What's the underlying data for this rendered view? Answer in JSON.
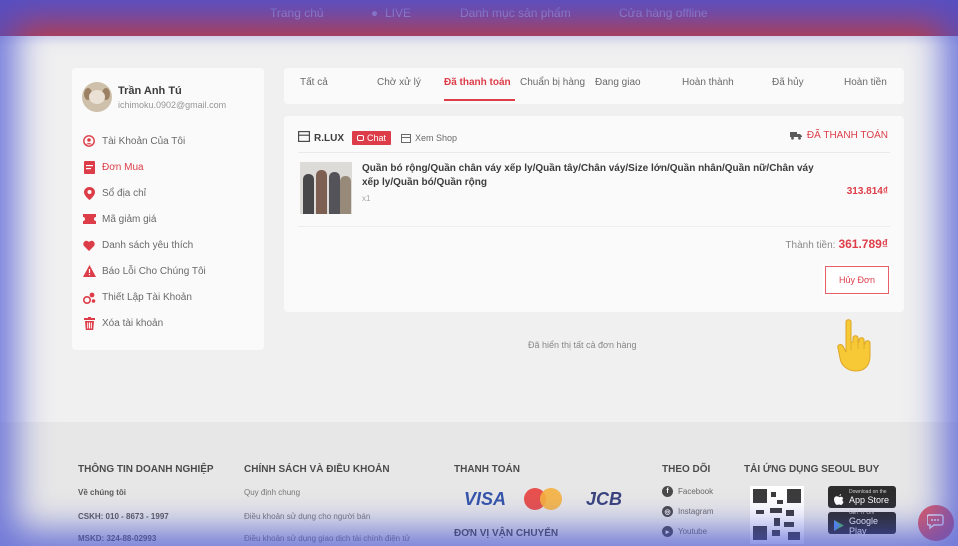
{
  "topnav": {
    "items": [
      "Trang chủ",
      "LIVE",
      "Danh mục sản phẩm",
      "Cửa hàng offline"
    ]
  },
  "user": {
    "name": "Trần Anh Tú",
    "email": "ichimoku.0902@gmail.com"
  },
  "sidebar": {
    "items": [
      {
        "label": "Tài Khoản Của Tôi",
        "icon": "user-circle-icon"
      },
      {
        "label": "Đơn Mua",
        "icon": "order-document-icon"
      },
      {
        "label": "Sổ địa chỉ",
        "icon": "location-pin-icon"
      },
      {
        "label": "Mã giảm giá",
        "icon": "ticket-icon"
      },
      {
        "label": "Danh sách yêu thích",
        "icon": "heart-icon"
      },
      {
        "label": "Báo Lỗi Cho Chúng Tôi",
        "icon": "warning-icon"
      },
      {
        "label": "Thiết Lập Tài Khoản",
        "icon": "settings-people-icon"
      },
      {
        "label": "Xóa tài khoản",
        "icon": "trash-icon"
      }
    ],
    "active_index": 1
  },
  "tabs": {
    "items": [
      "Tất cả",
      "Chờ xử lý",
      "Đã thanh toán",
      "Chuẩn bị hàng",
      "Đang giao",
      "Hoàn thành",
      "Đã hủy",
      "Hoàn tiền"
    ],
    "active_index": 2
  },
  "order": {
    "shop_name": "R.LUX",
    "chat_label": "Chat",
    "view_shop_label": "Xem Shop",
    "status": "ĐÃ THANH TOÁN",
    "product_title": "Quần bó rộng/Quần chân váy xếp ly/Quần tây/Chân váy/Size lớn/Quần nhân/Quần nữ/Chân váy xếp ly/Quần bó/Quần rộng",
    "quantity": "x1",
    "price": "313.814₫",
    "total_label": "Thành tiền:",
    "total_amount": "361.789₫",
    "cancel_label": "Hủy Đơn"
  },
  "all_shown": "Đã hiển thị tất cả đơn hàng",
  "footer": {
    "col1": {
      "title": "THÔNG TIN DOANH NGHIỆP",
      "items": [
        "Về chúng tôi",
        "CSKH: 010 - 8673 - 1997",
        "MSKD: 324-88-02993"
      ]
    },
    "col2": {
      "title": "CHÍNH SÁCH VÀ ĐIỀU KHOẢN",
      "items": [
        "Quy định chung",
        "Điều khoản sử dụng cho người bán",
        "Điều khoản sử dụng giao dịch tài chính điện tử"
      ]
    },
    "col3": {
      "title": "THANH TOÁN",
      "logos": [
        "VISA",
        "MasterCard",
        "JCB"
      ],
      "shipping_title": "ĐƠN VỊ VẬN CHUYỂN"
    },
    "col4": {
      "title": "THEO DÕI",
      "items": [
        "Facebook",
        "Instagram",
        "Youtube"
      ]
    },
    "col5": {
      "title": "TẢI ỨNG DỤNG SEOUL BUY",
      "app_store": {
        "small": "Download on the",
        "large": "App Store"
      },
      "google_play": {
        "small": "GET IT ON",
        "large": "Google Play"
      }
    }
  },
  "colors": {
    "accent": "#d9232f",
    "nav": "#b3202a",
    "overlay": "#4650d2"
  }
}
